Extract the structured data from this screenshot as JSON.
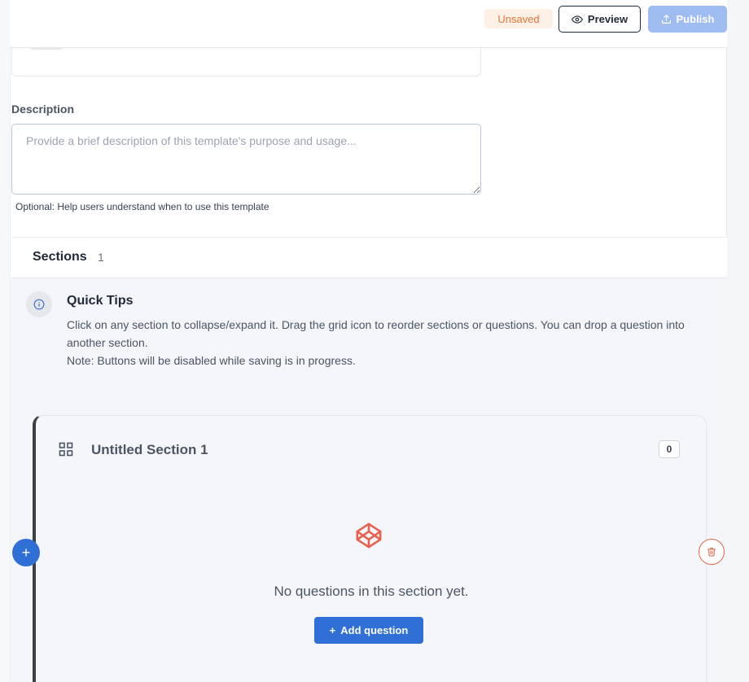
{
  "header": {
    "status_badge": "Unsaved",
    "preview_label": "Preview",
    "publish_label": "Publish"
  },
  "description": {
    "label": "Description",
    "placeholder": "Provide a brief description of this template's purpose and usage...",
    "value": "",
    "hint": "Optional: Help users understand when to use this template"
  },
  "sections": {
    "title": "Sections",
    "count": "1"
  },
  "tips": {
    "title": "Quick Tips",
    "line1": "Click on any section to collapse/expand it. Drag the grid icon to reorder sections or questions. You can drop a question into another section.",
    "line2": "Note: Buttons will be disabled while saving is in progress."
  },
  "section_card": {
    "title": "Untitled Section 1",
    "question_count": "0",
    "empty_text": "No questions in this section yet.",
    "add_question_label": "Add question"
  },
  "icons": {
    "preview": "eye-icon",
    "publish": "upload-icon",
    "tips": "info-icon",
    "drag": "grid-icon",
    "empty": "codepen-cube-icon",
    "add_section": "plus-icon",
    "delete_section": "trash-icon"
  },
  "colors": {
    "accent": "#2f6fd6",
    "publish_disabled": "#9ebcf0",
    "unsaved_text": "#e0763a",
    "unsaved_bg": "#fdf0e4",
    "danger": "#e0664b"
  }
}
